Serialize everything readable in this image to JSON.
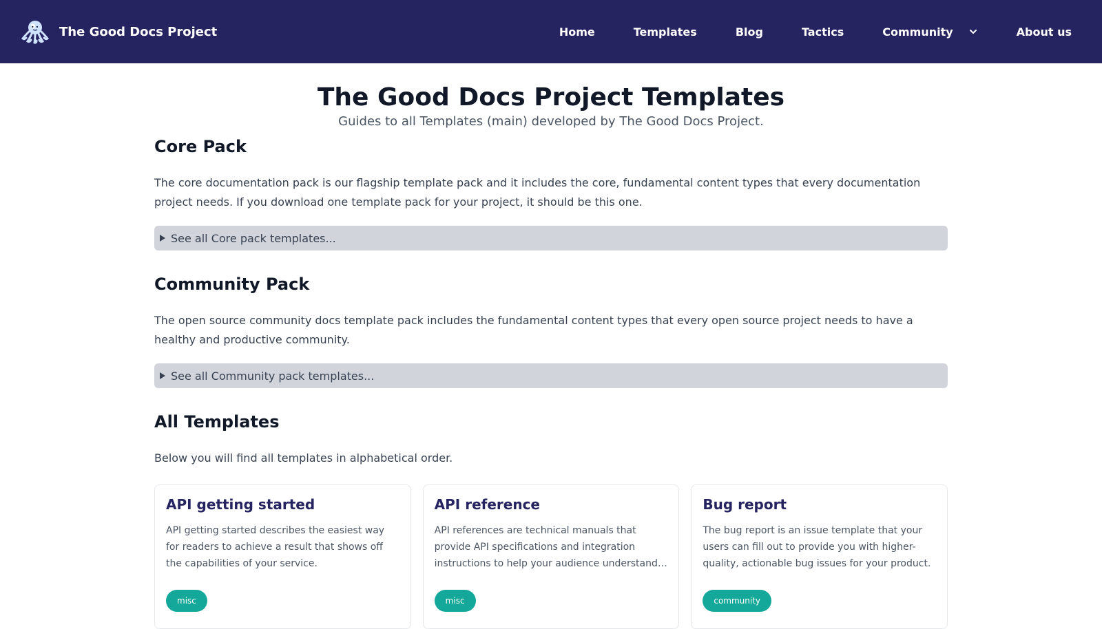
{
  "header": {
    "brand_name": "The Good Docs Project",
    "logo_icon": "octopus-logo-icon",
    "nav": [
      {
        "label": "Home"
      },
      {
        "label": "Templates"
      },
      {
        "label": "Blog"
      },
      {
        "label": "Tactics"
      },
      {
        "label": "Community",
        "has_dropdown": true
      },
      {
        "label": "About us"
      }
    ]
  },
  "main": {
    "title": "The Good Docs Project Templates",
    "subtitle": "Guides to all Templates (main) developed by The Good Docs Project.",
    "sections": [
      {
        "title": "Core Pack",
        "description": "The core documentation pack is our flagship template pack and it includes the core, fundamental content types that every documentation project needs. If you download one template pack for your project, it should be this one.",
        "details_label": "See all Core pack templates..."
      },
      {
        "title": "Community Pack",
        "description": "The open source community docs template pack includes the fundamental content types that every open source project needs to have a healthy and productive community.",
        "details_label": "See all Community pack templates..."
      },
      {
        "title": "All Templates",
        "description": "Below you will find all templates in alphabetical order."
      }
    ],
    "cards": [
      {
        "title": "API getting started",
        "description": "API getting started describes the easiest way for readers to achieve a result that shows off the capabilities of your service.",
        "tag": "misc"
      },
      {
        "title": "API reference",
        "description": "API references are technical manuals that provide API specifications and integration instructions to help your audience understand…",
        "tag": "misc"
      },
      {
        "title": "Bug report",
        "description": "The bug report is an issue template that your users can fill out to provide you with higher-quality, actionable bug issues for your product.",
        "tag": "community"
      }
    ]
  },
  "colors": {
    "header_bg": "#252360",
    "tag_bg": "#14a89a",
    "details_bg": "#d1d5db",
    "card_title": "#252360"
  }
}
